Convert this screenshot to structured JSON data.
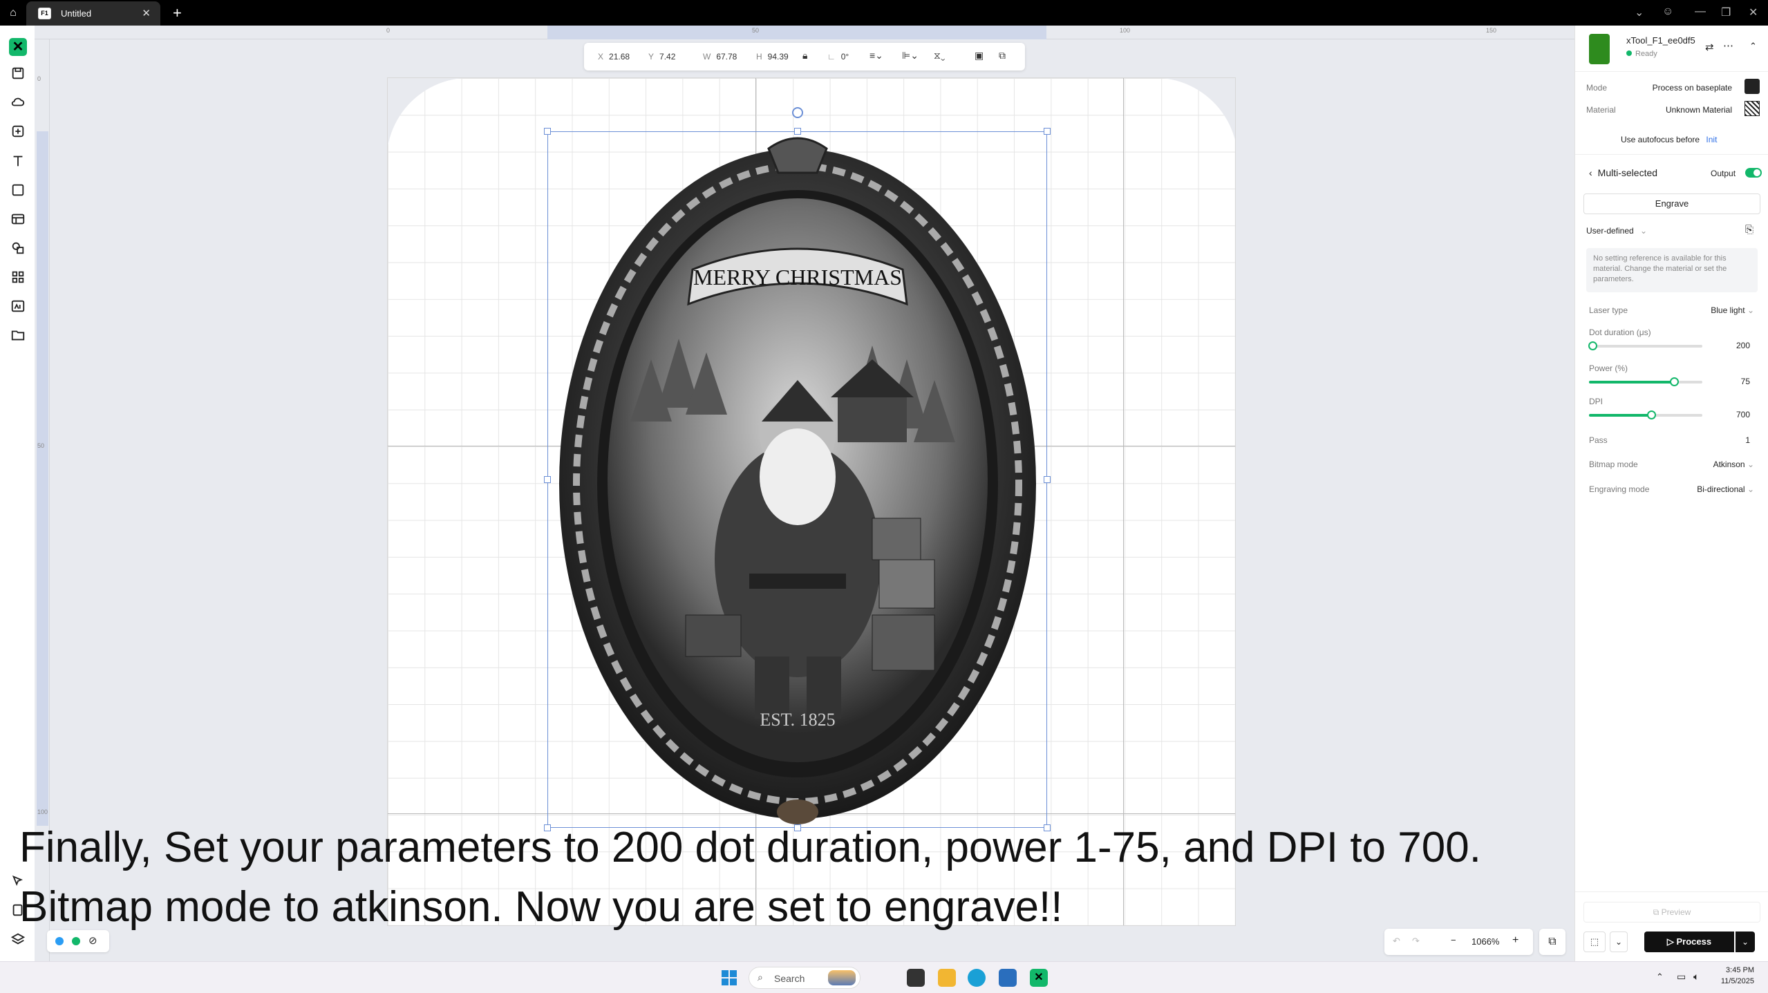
{
  "titlebar": {
    "tab_label": "Untitled",
    "tab_icon": "F1"
  },
  "toolbar": {
    "x_label": "X",
    "x_value": "21.68",
    "y_label": "Y",
    "y_value": "7.42",
    "w_label": "W",
    "w_value": "67.78",
    "h_label": "H",
    "h_value": "94.39",
    "rotation": "0°"
  },
  "rulers": {
    "top": [
      "0",
      "50",
      "100",
      "150"
    ],
    "left": [
      "0",
      "50",
      "100"
    ]
  },
  "artwork": {
    "banner_text": "MERRY CHRISTMAS",
    "bottom_text": "EST. 1825"
  },
  "device": {
    "name": "xTool_F1_ee0df5",
    "status": "Ready"
  },
  "settings": {
    "mode_label": "Mode",
    "mode_value": "Process on baseplate",
    "material_label": "Material",
    "material_value": "Unknown Material",
    "autofocus_label": "Use autofocus before",
    "autofocus_link": "Init",
    "multi_selected": "Multi-selected",
    "output_label": "Output",
    "engrave_button": "Engrave",
    "preset": "User-defined",
    "notice": "No setting reference is available for this material. Change the material or set the parameters.",
    "laser_type_label": "Laser type",
    "laser_type_value": "Blue light",
    "dot_duration_label": "Dot duration (μs)",
    "dot_duration_value": "200",
    "dot_duration_fraction": 0.03,
    "power_label": "Power (%)",
    "power_value": "75",
    "power_fraction": 0.75,
    "dpi_label": "DPI",
    "dpi_value": "700",
    "dpi_fraction": 0.55,
    "pass_label": "Pass",
    "pass_value": "1",
    "bitmap_label": "Bitmap mode",
    "bitmap_value": "Atkinson",
    "engraving_mode_label": "Engraving mode",
    "engraving_mode_value": "Bi-directional",
    "preview_button": "Preview",
    "process_button": "Process"
  },
  "zoom": {
    "value": "1066%"
  },
  "caption": {
    "line1": "Finally, Set your parameters to 200 dot duration, power 1-75, and DPI to 700.",
    "line2": "Bitmap mode to atkinson. Now you are set to engrave!!"
  },
  "taskbar": {
    "search_label": "Search",
    "time": "3:45 PM",
    "date": "11/5/2025"
  },
  "colors": {
    "accent": "#12b76a",
    "selection": "#6b8fd6"
  }
}
